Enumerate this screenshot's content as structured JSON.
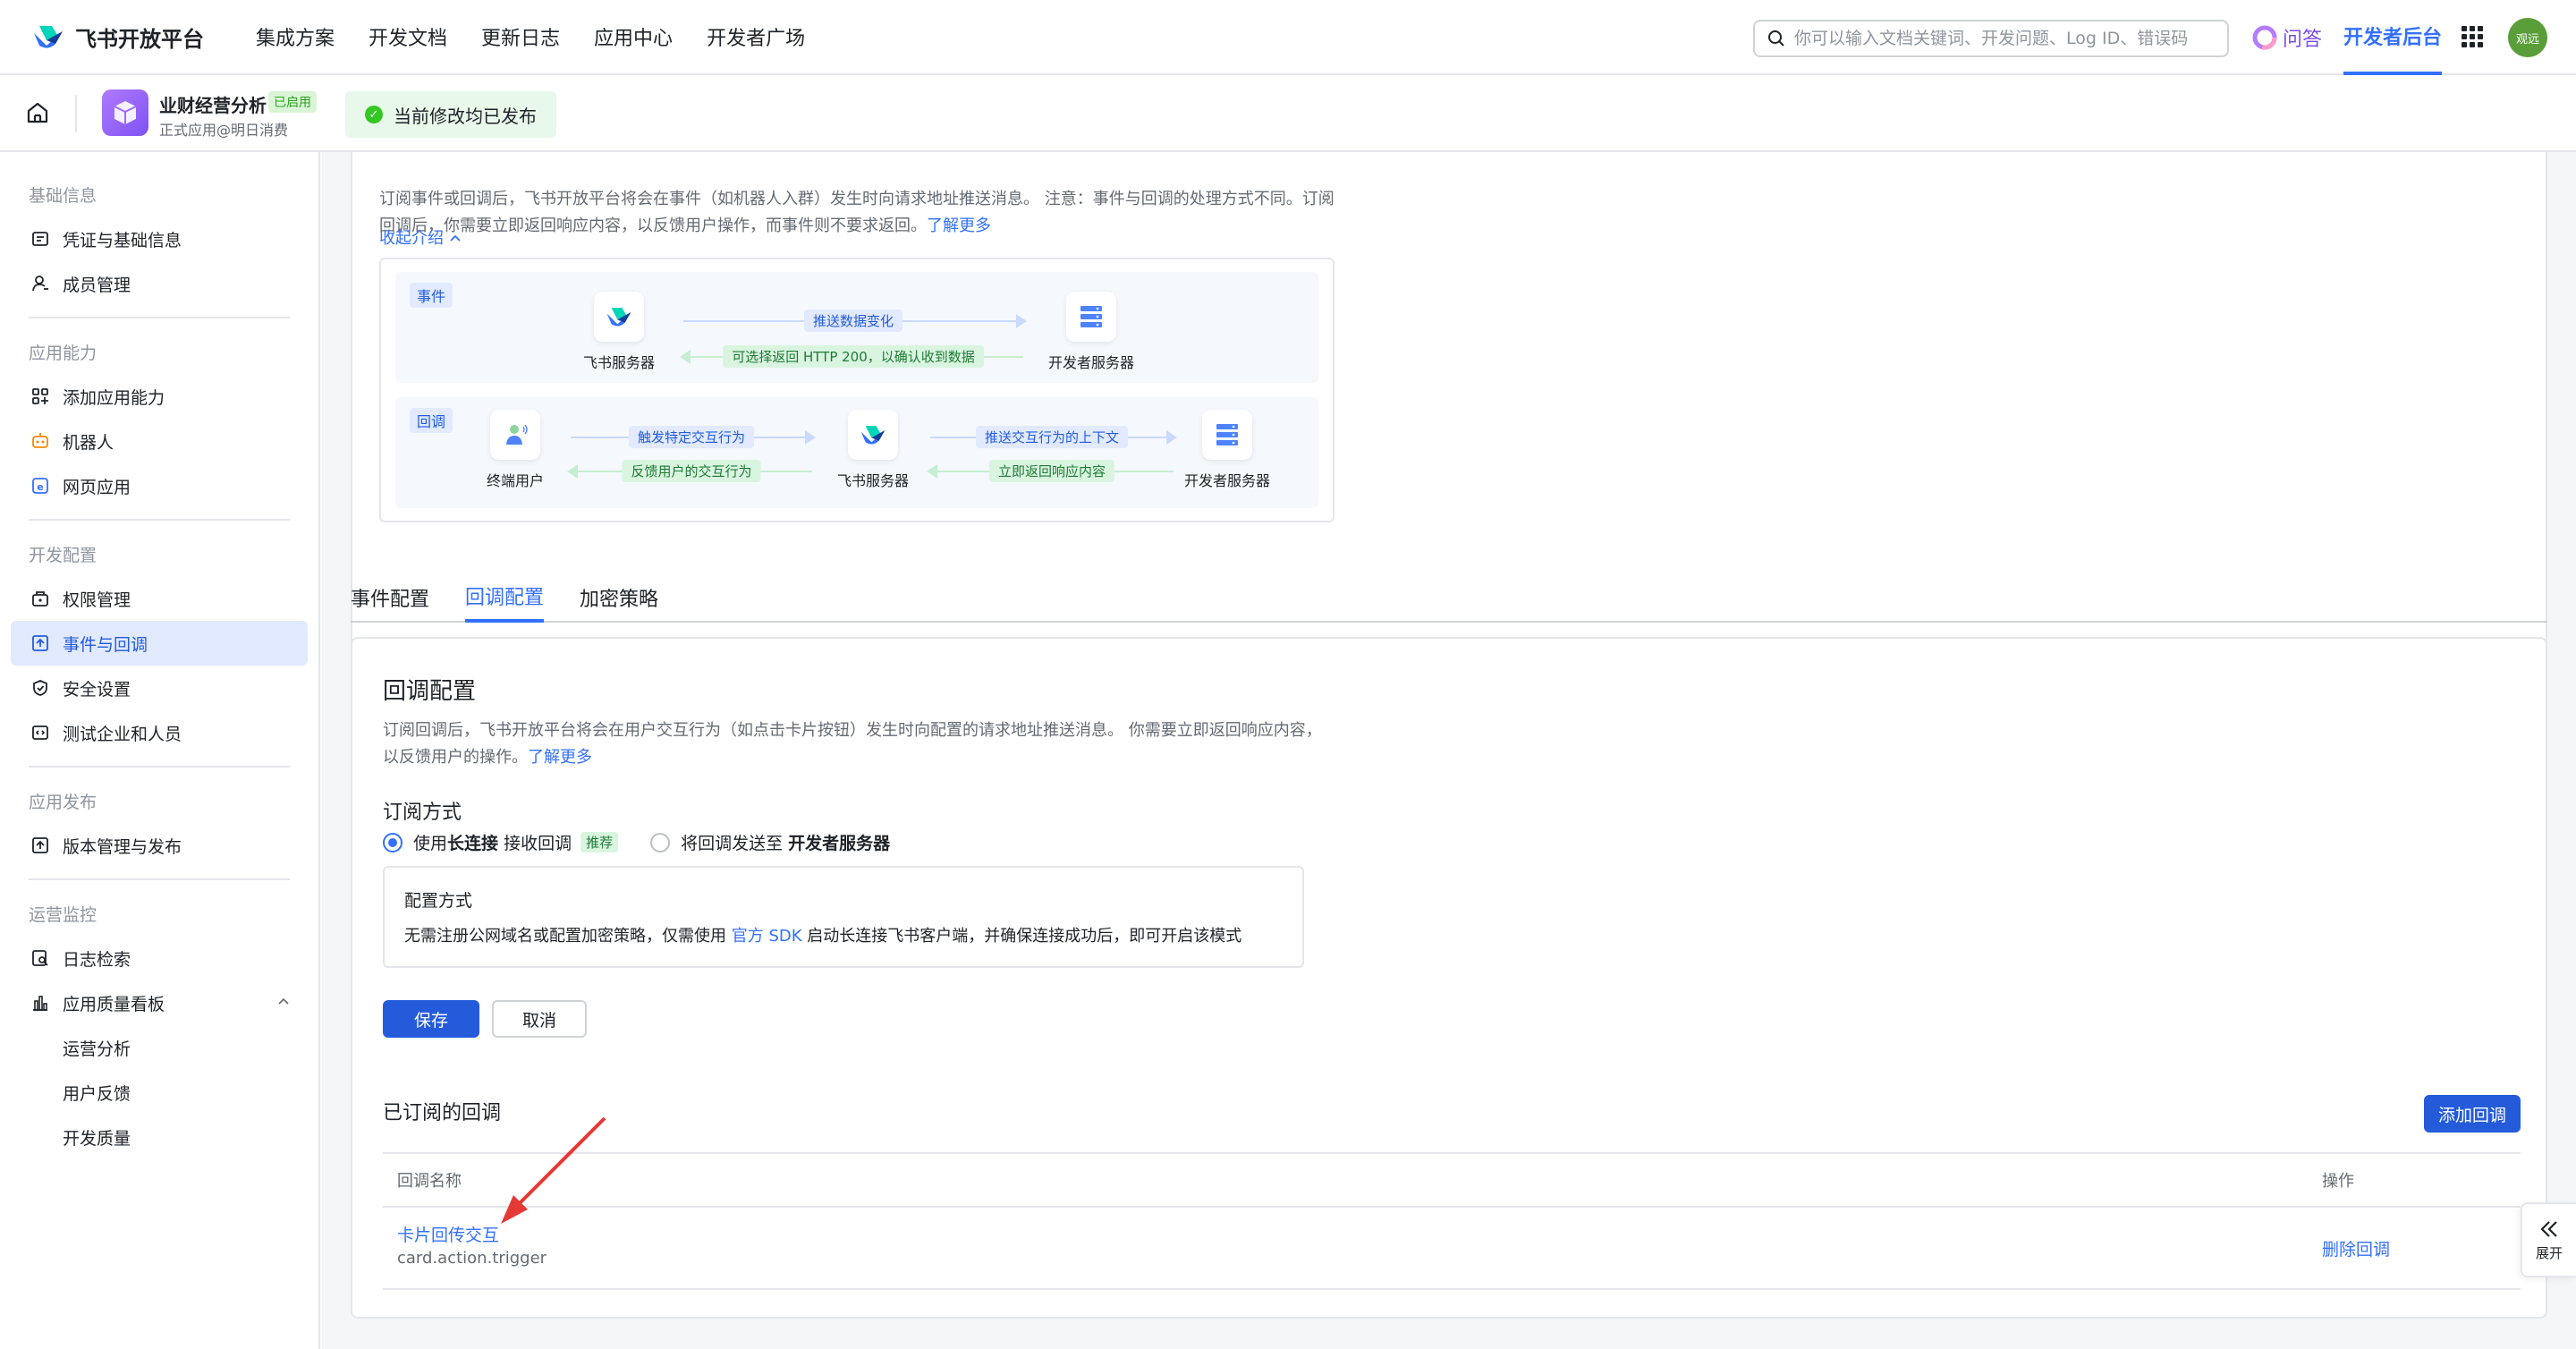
{
  "topnav": {
    "brand": "飞书开放平台",
    "links": [
      "集成方案",
      "开发文档",
      "更新日志",
      "应用中心",
      "开发者广场"
    ],
    "search_placeholder": "你可以输入文档关键词、开发问题、Log ID、错误码",
    "qa_label": "问答",
    "console_label": "开发者后台",
    "avatar_text": "观远"
  },
  "app_header": {
    "name": "业财经营分析",
    "badge": "已启用",
    "subtitle": "正式应用@明日消费",
    "publish_status": "当前修改均已发布"
  },
  "sidebar": {
    "groups": {
      "basic": "基础信息",
      "ability": "应用能力",
      "dev": "开发配置",
      "release": "应用发布",
      "ops": "运营监控"
    },
    "items": {
      "credentials": "凭证与基础信息",
      "members": "成员管理",
      "add_ability": "添加应用能力",
      "bot": "机器人",
      "web_app": "网页应用",
      "permissions": "权限管理",
      "events": "事件与回调",
      "security": "安全设置",
      "test_org": "测试企业和人员",
      "versions": "版本管理与发布",
      "logs": "日志检索",
      "quality": "应用质量看板"
    },
    "subitems": [
      "运营分析",
      "用户反馈",
      "开发质量"
    ]
  },
  "intro": {
    "text": "订阅事件或回调后，飞书开放平台将会在事件（如机器人入群）发生时向请求地址推送消息。 注意：事件与回调的处理方式不同。订阅回调后，你需要立即返回响应内容，以反馈用户操作，而事件则不要求返回。",
    "learn_more": "了解更多",
    "collapse": "收起介绍"
  },
  "diagram": {
    "event_tag": "事件",
    "callback_tag": "回调",
    "feishu_server": "飞书服务器",
    "dev_server": "开发者服务器",
    "end_user": "终端用户",
    "push_change": "推送数据变化",
    "optional_return": "可选择返回 HTTP 200，以确认收到数据",
    "trigger_action": "触发特定交互行为",
    "feedback_action": "反馈用户的交互行为",
    "push_context": "推送交互行为的上下文",
    "immediate_return": "立即返回响应内容"
  },
  "tabs": [
    "事件配置",
    "回调配置",
    "加密策略"
  ],
  "callback_config": {
    "title": "回调配置",
    "desc": "订阅回调后，飞书开放平台将会在用户交互行为（如点击卡片按钮）发生时向配置的请求地址推送消息。 你需要立即返回响应内容，以反馈用户的操作。",
    "learn_more": "了解更多",
    "subscribe_title": "订阅方式",
    "option1_pre": "使用 ",
    "option1_bold": "长连接",
    "option1_post": " 接收回调",
    "recommend": "推荐",
    "option2_pre": "将回调发送至 ",
    "option2_bold": "开发者服务器",
    "mode_title": "配置方式",
    "mode_text_pre": "无需注册公网域名或配置加密策略，仅需使用 ",
    "mode_link": "官方 SDK",
    "mode_text_post": " 启动长连接飞书客户端，并确保连接成功后，即可开启该模式",
    "save": "保存",
    "cancel": "取消",
    "subscribed_title": "已订阅的回调",
    "add_callback": "添加回调",
    "col_name": "回调名称",
    "col_action": "操作",
    "rows": [
      {
        "name": "卡片回传交互",
        "key": "card.action.trigger",
        "action": "删除回调"
      }
    ]
  },
  "expand_label": "展开",
  "colors": {
    "primary": "#3370ff",
    "button": "#245bdb",
    "annotation": "#e53935"
  }
}
